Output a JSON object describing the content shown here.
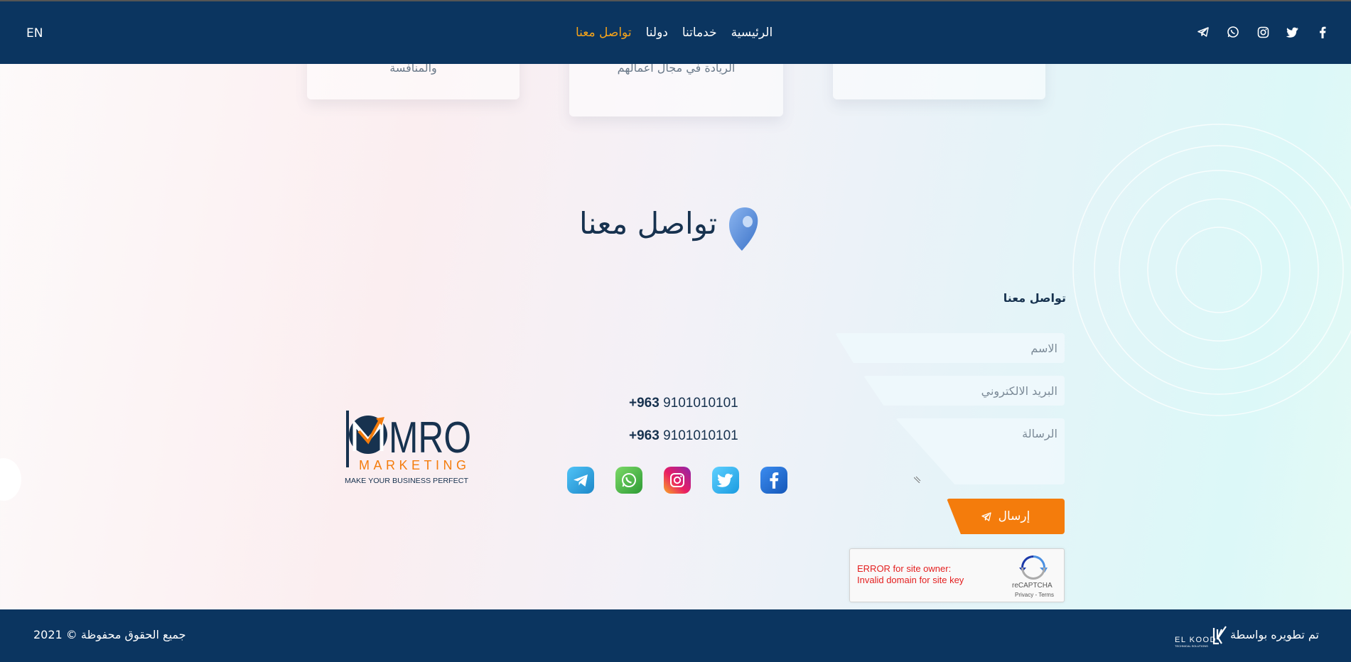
{
  "nav": {
    "lang_label": "EN",
    "items": [
      {
        "label": "الرئيسية",
        "active": false
      },
      {
        "label": "خدماتنا",
        "active": false
      },
      {
        "label": "دولنا",
        "active": false
      },
      {
        "label": "تواصل معنا",
        "active": true
      }
    ],
    "social": [
      "facebook-icon",
      "twitter-icon",
      "instagram-icon",
      "whatsapp-icon",
      "telegram-icon"
    ]
  },
  "cards": [
    {
      "text": "والمنافسة"
    },
    {
      "text": "الريادة في مجال اعمالهم"
    },
    {
      "text": ""
    }
  ],
  "contact": {
    "section_title": "تواصل معنا",
    "form_title": "تواصل معنا",
    "name_placeholder": "الاسم",
    "email_placeholder": "البريد الالكتروني",
    "message_placeholder": "الرسالة",
    "send_label": "إرسال",
    "phones": [
      {
        "code": "+963",
        "number": "9101010101"
      },
      {
        "code": "+963",
        "number": "9101010101"
      }
    ],
    "social": [
      "telegram-icon",
      "whatsapp-icon",
      "instagram-icon",
      "twitter-icon",
      "facebook-icon"
    ]
  },
  "recaptcha": {
    "error_line1": "ERROR for site owner:",
    "error_line2": "Invalid domain for site key",
    "brand": "reCAPTCHA",
    "links": "Privacy - Terms"
  },
  "logo": {
    "main": "MRO",
    "sub": "MARKETING",
    "tagline": "MAKE YOUR BUSINESS PERFECT"
  },
  "footer": {
    "copyright": "جميع الحقوق محفوظة © 2021",
    "developed_by": "تم تطويره بواسطة",
    "dev_brand": "EL KOOD",
    "dev_brand_sub": "TECHNICAL SOLUTIONS"
  },
  "colors": {
    "navy": "#0b3560",
    "accent_orange": "#f47c0c",
    "active_nav": "#f5a31a"
  }
}
